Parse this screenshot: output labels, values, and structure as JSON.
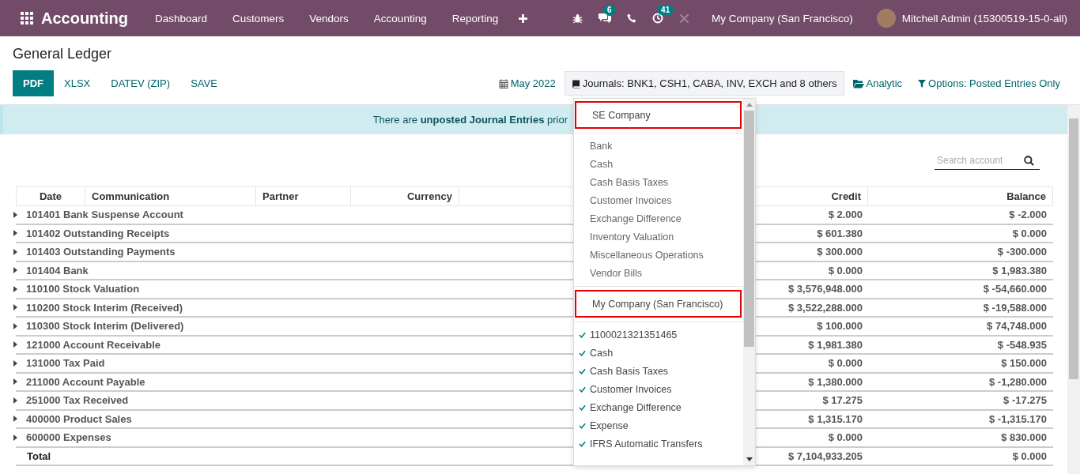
{
  "navbar": {
    "app_name": "Accounting",
    "menu": [
      "Dashboard",
      "Customers",
      "Vendors",
      "Accounting",
      "Reporting"
    ],
    "messages_badge": "6",
    "activities_badge": "41",
    "company": "My Company (San Francisco)",
    "user": "Mitchell Admin (15300519-15-0-all)"
  },
  "title": "General Ledger",
  "actions": [
    {
      "label": "PDF",
      "primary": true
    },
    {
      "label": "XLSX",
      "primary": false
    },
    {
      "label": "DATEV (ZIP)",
      "primary": false
    },
    {
      "label": "SAVE",
      "primary": false
    }
  ],
  "filters": {
    "date": "May 2022",
    "journals": {
      "label": "Journals: BNK1, CSH1, CABA, INV, EXCH and 8 others",
      "expanded": true
    },
    "analytic": "Analytic",
    "options": "Options: Posted Entries Only"
  },
  "banner": "There are **unposted Journal Entries** prior",
  "search": {
    "placeholder": "Search account"
  },
  "columns": [
    "Date",
    "Communication",
    "Partner",
    "Currency",
    "Credit",
    "Balance"
  ],
  "rows": [
    {
      "kind": "account",
      "account": "101401 Bank Suspense Account",
      "credit": "$ 2.000",
      "balance": "$ -2.000"
    },
    {
      "kind": "account",
      "account": "101402 Outstanding Receipts",
      "credit": "$ 601.380",
      "balance": "$ 0.000"
    },
    {
      "kind": "account",
      "account": "101403 Outstanding Payments",
      "credit": "$ 300.000",
      "balance": "$ -300.000"
    },
    {
      "kind": "account",
      "account": "101404 Bank",
      "credit": "$ 0.000",
      "balance": "$ 1,983.380"
    },
    {
      "kind": "account",
      "account": "110100 Stock Valuation",
      "credit": "$ 3,576,948.000",
      "balance": "$ -54,660.000"
    },
    {
      "kind": "account",
      "account": "110200 Stock Interim (Received)",
      "credit": "$ 3,522,288.000",
      "balance": "$ -19,588.000"
    },
    {
      "kind": "account",
      "account": "110300 Stock Interim (Delivered)",
      "credit": "$ 100.000",
      "balance": "$ 74,748.000"
    },
    {
      "kind": "account",
      "account": "121000 Account Receivable",
      "credit": "$ 1,981.380",
      "balance": "$ -548.935"
    },
    {
      "kind": "account",
      "account": "131000 Tax Paid",
      "credit": "$ 0.000",
      "balance": "$ 150.000"
    },
    {
      "kind": "account",
      "account": "211000 Account Payable",
      "credit": "$ 1,380.000",
      "balance": "$ -1,280.000"
    },
    {
      "kind": "account",
      "account": "251000 Tax Received",
      "credit": "$ 17.275",
      "balance": "$ -17.275"
    },
    {
      "kind": "account",
      "account": "400000 Product Sales",
      "credit": "$ 1,315.170",
      "balance": "$ -1,315.170"
    },
    {
      "kind": "account",
      "account": "600000 Expenses",
      "credit": "$ 0.000",
      "balance": "$ 830.000"
    },
    {
      "kind": "total",
      "account": "Total",
      "credit": "$ 7,104,933.205",
      "balance": "$ 0.000"
    }
  ],
  "journal_groups": [
    {
      "company": "SE Company",
      "items": [
        {
          "label": "Bank",
          "checked": false
        },
        {
          "label": "Cash",
          "checked": false
        },
        {
          "label": "Cash Basis Taxes",
          "checked": false
        },
        {
          "label": "Customer Invoices",
          "checked": false
        },
        {
          "label": "Exchange Difference",
          "checked": false
        },
        {
          "label": "Inventory Valuation",
          "checked": false
        },
        {
          "label": "Miscellaneous Operations",
          "checked": false
        },
        {
          "label": "Vendor Bills",
          "checked": false
        }
      ]
    },
    {
      "company": "My Company (San Francisco)",
      "items": [
        {
          "label": "1100021321351465",
          "checked": true
        },
        {
          "label": "Cash",
          "checked": true
        },
        {
          "label": "Cash Basis Taxes",
          "checked": true
        },
        {
          "label": "Customer Invoices",
          "checked": true
        },
        {
          "label": "Exchange Difference",
          "checked": true
        },
        {
          "label": "Expense",
          "checked": true
        },
        {
          "label": "IFRS Automatic Transfers",
          "checked": true
        }
      ]
    }
  ]
}
